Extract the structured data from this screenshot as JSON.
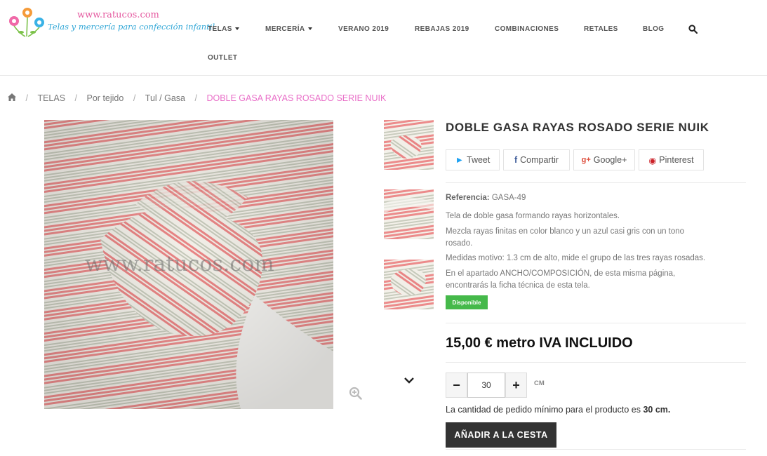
{
  "header": {
    "logo_url_text": "www.ratucos.com",
    "logo_tagline": "Telas y mercería para confección infantil",
    "nav": [
      {
        "label": "TELAS",
        "dropdown": true
      },
      {
        "label": "MERCERÍA",
        "dropdown": true
      },
      {
        "label": "VERANO 2019",
        "dropdown": false
      },
      {
        "label": "REBAJAS 2019",
        "dropdown": false
      },
      {
        "label": "COMBINACIONES",
        "dropdown": false
      },
      {
        "label": "RETALES",
        "dropdown": false
      },
      {
        "label": "BLOG",
        "dropdown": false
      },
      {
        "label": "OUTLET",
        "dropdown": false
      }
    ]
  },
  "breadcrumb": {
    "items": [
      "TELAS",
      "Por tejido",
      "Tul / Gasa"
    ],
    "current": "DOBLE GASA RAYAS ROSADO SERIE NUIK"
  },
  "product": {
    "title": "DOBLE GASA RAYAS ROSADO SERIE NUIK",
    "image_watermark": "www.ratucos.com",
    "share": {
      "tweet": "Tweet",
      "facebook": "Compartir",
      "google": "Google+",
      "pinterest": "Pinterest"
    },
    "reference_label": "Referencia:",
    "reference_value": "GASA-49",
    "description": [
      "Tela de doble gasa formando rayas horizontales.",
      "Mezcla rayas finitas en color blanco y un azul casi gris con un tono",
      "rosado.",
      "Medidas motivo: 1.3 cm de alto, mide el grupo de las tres rayas rosadas.",
      "En el apartado ANCHO/COMPOSICIÓN, de esta misma página,",
      "encontrarás la ficha técnica de esta tela."
    ],
    "availability": "Disponible",
    "price": "15,00 € metro IVA INCLUIDO",
    "quantity": "30",
    "quantity_unit": "CM",
    "min_order_text": "La cantidad de pedido mínimo para el producto es",
    "min_order_value": "30 cm.",
    "add_to_cart": "AÑADIR A LA CESTA"
  },
  "colors": {
    "accent_pink": "#e96fc8",
    "available_green": "#45b94a",
    "button_dark": "#333333",
    "stripe_pink": "#ec8b8b",
    "stripe_grey": "#c9ccbe"
  }
}
